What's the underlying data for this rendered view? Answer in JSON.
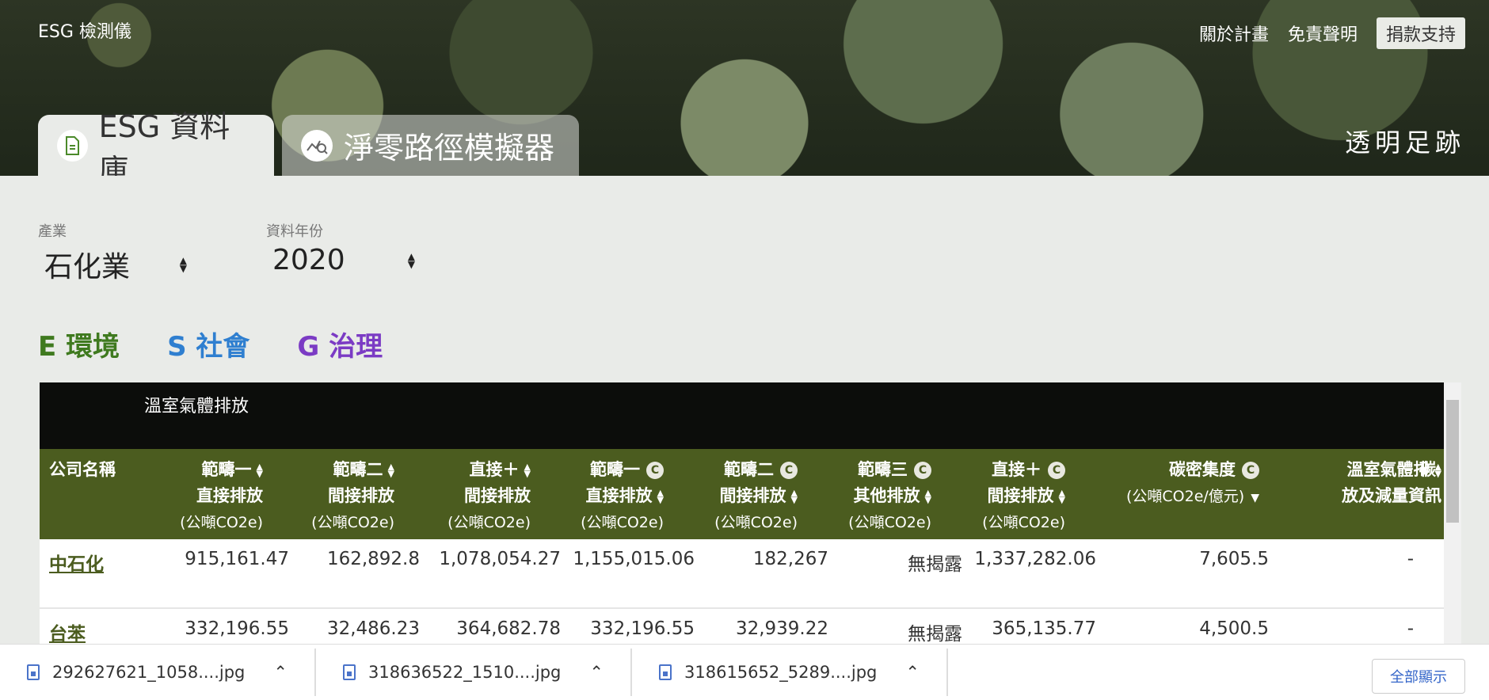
{
  "header": {
    "brand": "ESG 檢測儀",
    "nav": [
      "關於計畫",
      "免責聲明"
    ],
    "donate": "捐款支持",
    "slogan": "透明足跡"
  },
  "tabs": [
    {
      "label": "ESG 資料庫",
      "icon": "document-icon",
      "active": true
    },
    {
      "label": "淨零路徑模擬器",
      "icon": "chart-search-icon",
      "active": false
    }
  ],
  "filters": {
    "industry": {
      "label": "產業",
      "value": "石化業"
    },
    "year": {
      "label": "資料年份",
      "value": "2020"
    }
  },
  "esg_tabs": [
    {
      "label": "E 環境",
      "color": "#3f7a1f"
    },
    {
      "label": "S 社會",
      "color": "#2f7fd0"
    },
    {
      "label": "G 治理",
      "color": "#7b3bc4"
    }
  ],
  "table": {
    "group_header": "溫室氣體排放",
    "columns": [
      {
        "l1": "公司名稱",
        "l2": "",
        "unit": ""
      },
      {
        "l1": "範疇一",
        "l2": "直接排放",
        "unit": "(公噸CO2e)"
      },
      {
        "l1": "範疇二",
        "l2": "間接排放",
        "unit": "(公噸CO2e)"
      },
      {
        "l1": "直接＋",
        "l2": "間接排放",
        "unit": "(公噸CO2e)"
      },
      {
        "l1": "範疇一",
        "l2": "直接排放",
        "unit": "(公噸CO2e)"
      },
      {
        "l1": "範疇二",
        "l2": "間接排放",
        "unit": "(公噸CO2e)"
      },
      {
        "l1": "範疇三",
        "l2": "其他排放",
        "unit": "(公噸CO2e)"
      },
      {
        "l1": "直接＋",
        "l2": "間接排放",
        "unit": "(公噸CO2e)"
      },
      {
        "l1": "碳密集度",
        "l2": "(公噸CO2e/億元)",
        "unit": ""
      },
      {
        "l1": "溫室氣體排",
        "l2": "放及減量資訊",
        "unit": ""
      },
      {
        "l1": "碳",
        "l2": "",
        "unit": ""
      }
    ],
    "rows": [
      [
        "中石化",
        "915,161.47",
        "162,892.8",
        "1,078,054.27",
        "1,155,015.06",
        "182,267",
        "無揭露",
        "1,337,282.06",
        "7,605.5",
        "-"
      ],
      [
        "台苯",
        "332,196.55",
        "32,486.23",
        "364,682.78",
        "332,196.55",
        "32,939.22",
        "無揭露",
        "365,135.77",
        "4,500.5",
        "-"
      ]
    ]
  },
  "downloads": [
    {
      "name": "292627621_1058....jpg"
    },
    {
      "name": "318636522_1510....jpg"
    },
    {
      "name": "318615652_5289....jpg"
    }
  ],
  "show_all": "全部顯示"
}
